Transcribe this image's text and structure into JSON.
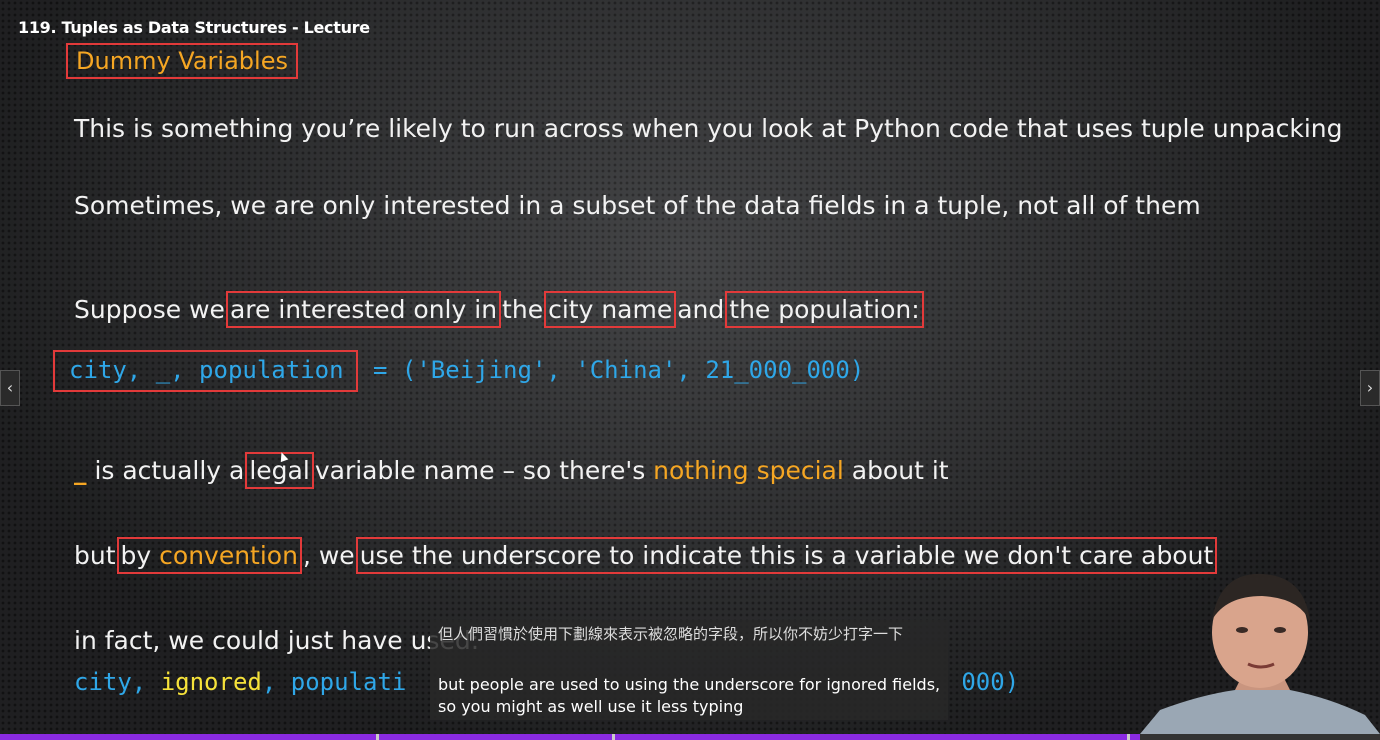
{
  "lecture_title": "119. Tuples as Data Structures - Lecture",
  "slide": {
    "heading": "Dummy Variables",
    "line1": "This is something you’re likely to run across when you look at Python code that uses tuple unpacking",
    "line2": "Sometimes, we are only interested in a subset of the data fields in a tuple, not all of them",
    "line3": {
      "p1": "Suppose we",
      "b1": "are interested only in",
      "p2": "the",
      "b2": "city name",
      "p3": "and",
      "b3": "the population:"
    },
    "code1": {
      "boxed": "city, _, population",
      "rest": " = ('Beijing', 'China', 21_000_000)"
    },
    "line5": {
      "underscore": "_",
      "p1": " is actually a",
      "b1": "legal",
      "p2": "variable name – so there's ",
      "highlight": "nothing special",
      "p3": " about it"
    },
    "line6": {
      "p1": "but",
      "b1_p": "by ",
      "b1_h": "convention",
      "p2": ", we",
      "b2": "use the underscore to indicate this is a variable we don't care about"
    },
    "line7": "in fact, we could just have used:",
    "code2": {
      "a": "city, ",
      "b": "ignored",
      "c": ", populati",
      "d": "000)"
    }
  },
  "captions": {
    "zh": "但人們習慣於使用下劃線來表示被忽略的字段，所以你不妨少打字一下",
    "en": "but people are used to using the underscore for ignored fields, so you might as well use it less typing"
  },
  "nav": {
    "prev": "‹",
    "next": "›"
  },
  "progress": {
    "fraction": 0.826
  },
  "colors": {
    "accent_orange": "#f5a623",
    "box_red": "#e23a3a",
    "code_blue": "#2fa7e8",
    "progress_purple": "#8a2be2"
  }
}
